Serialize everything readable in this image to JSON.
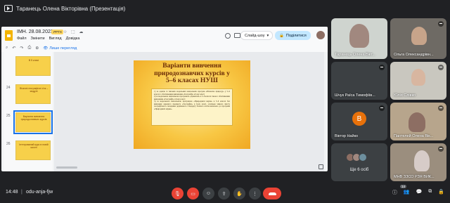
{
  "presenter": {
    "label": "Таранець Олена Вікторівна (Презентація)"
  },
  "slides_app": {
    "doc_title": "ІМН. 28.08.2023",
    "file_badge": ".PPTX",
    "title_icons": "☆ ⬚ ☁",
    "menu": [
      "Файл",
      "Змінити",
      "Вигляд",
      "Довідка"
    ],
    "toolbar": {
      "search": "⌕",
      "undo": "↶",
      "redo": "↷",
      "print": "⎙",
      "zoom": "⊕"
    },
    "view_only_label": "Лише перегляд",
    "slideshow_label": "Слайд-шоу",
    "share_label": "Поділитися",
    "thumbnails": [
      {
        "num": "",
        "text": "В 5 класі"
      },
      {
        "num": "24",
        "text": "Фізичні географічні з'єк – модулі"
      },
      {
        "num": "25",
        "text": "Варіанти вивчення природознавчих курсів"
      },
      {
        "num": "26",
        "text": "Інтегрований курс в новій школі"
      }
    ],
    "slide": {
      "title_lines": [
        "Варіанти вивчення",
        "природознавчих курсів у",
        "5–6 класах НУШ"
      ],
      "body": [
        "1) за однією зі типових модельних навчальних програм «Пізнаємо природу» у 5–6 класах з обов'язковим вивченням «Географії» в 6-му класі;",
        "2) за модельною навчальною програмою «Довкілля» в 5–6 класах також з обов'язковим вивченням «Географії» в 6-му класі;",
        "3) за модельною навчальною програмою «Природничі науки» в 5–6 класах без вивчення окремого предмету «Географія» в 6-му класі, оскільки чимало змісту географічного складника державного стандарту базової освіти включено до програми «Природничі науки»."
      ]
    }
  },
  "participants": [
    {
      "name": "Таранець Олена Вікт...",
      "muted": false
    },
    {
      "name": "Ольга Олександрівн...",
      "muted": true
    },
    {
      "name": "Шчук Раїса Тимофіїв...",
      "muted": true
    },
    {
      "name": "Юлія Слівко",
      "muted": true
    },
    {
      "name": "Віктор Найко",
      "muted": true,
      "initial": "В"
    },
    {
      "name": "Пантелей Олена Вік...",
      "muted": true
    },
    {
      "name": "Ще 6 осіб",
      "muted": false
    },
    {
      "name": "МНВ ЗЗСО РЗЯ ВИК...",
      "muted": true
    }
  ],
  "bottom_bar": {
    "time": "14:48",
    "separator": "|",
    "meeting_code": "odu-anja-fjw",
    "controls": {
      "mic": "🎙",
      "camera": "▭",
      "emoji": "☺",
      "present": "⇪",
      "raise_hand": "✋",
      "more": "⋮"
    },
    "right": {
      "info": "ⓘ",
      "people": "👥",
      "chat": "💬",
      "activities": "⧉",
      "lock": "🔒"
    },
    "participant_count": "14"
  },
  "colors": {
    "accent": "#1a73e8",
    "end_call": "#ea4335",
    "slide_title": "#6b2c07"
  }
}
